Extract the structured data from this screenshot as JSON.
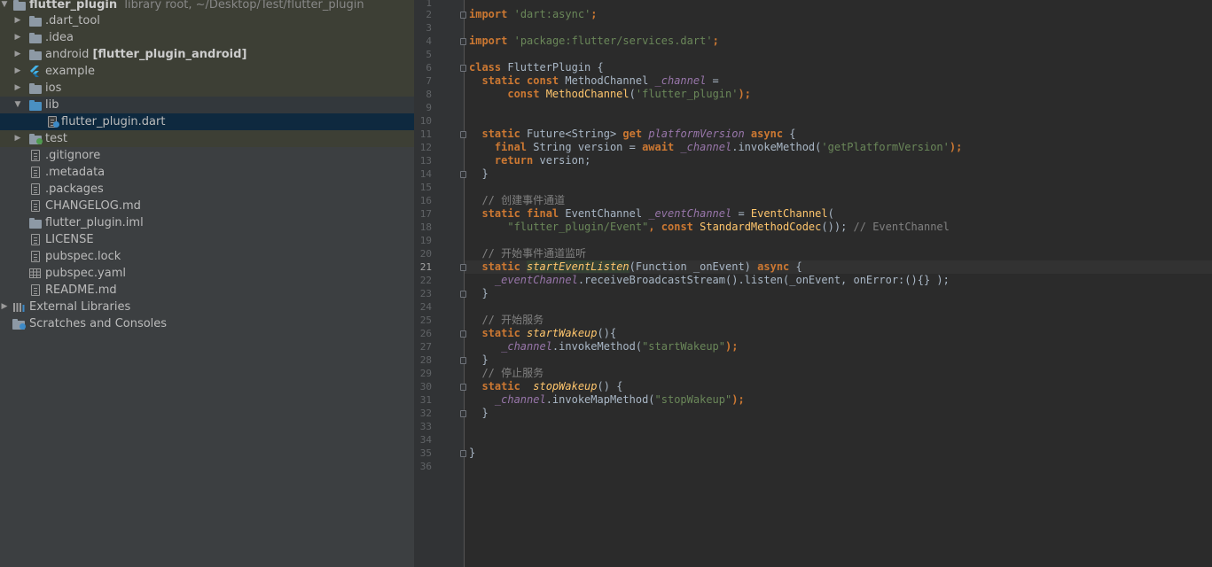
{
  "project_tree": {
    "root": {
      "name": "flutter_plugin",
      "subtitle": "library root,  ~/Desktop/Test/flutter_plugin"
    },
    "items": [
      {
        "label": ".dart_tool"
      },
      {
        "label": ".idea"
      },
      {
        "label": "android",
        "bold_suffix": "[flutter_plugin_android]"
      },
      {
        "label": "example"
      },
      {
        "label": "ios"
      },
      {
        "label": "lib"
      },
      {
        "label": "flutter_plugin.dart"
      },
      {
        "label": "test"
      },
      {
        "label": ".gitignore"
      },
      {
        "label": ".metadata"
      },
      {
        "label": ".packages"
      },
      {
        "label": "CHANGELOG.md"
      },
      {
        "label": "flutter_plugin.iml"
      },
      {
        "label": "LICENSE"
      },
      {
        "label": "pubspec.lock"
      },
      {
        "label": "pubspec.yaml"
      },
      {
        "label": "README.md"
      },
      {
        "label": "External Libraries"
      },
      {
        "label": "Scratches and Consoles"
      }
    ]
  },
  "editor": {
    "current_line": "21",
    "line_numbers": [
      "1",
      "2",
      "3",
      "4",
      "5",
      "6",
      "7",
      "8",
      "9",
      "10",
      "11",
      "12",
      "13",
      "14",
      "15",
      "16",
      "17",
      "18",
      "19",
      "20",
      "21",
      "22",
      "23",
      "24",
      "25",
      "26",
      "27",
      "28",
      "29",
      "30",
      "31",
      "32",
      "33",
      "34",
      "35",
      "36"
    ],
    "code": {
      "l2_kw": "import",
      "l2_str": "'dart:async'",
      "l2_end": ";",
      "l4_kw": "import",
      "l4_str": "'package:flutter/services.dart'",
      "l4_end": ";",
      "l6_kw": "class",
      "l6_rest": " FlutterPlugin {",
      "l7_kw": "static const",
      "l7_type": " MethodChannel ",
      "l7_fld": "_channel",
      "l7_end": " =",
      "l8_kw": "const",
      "l8_cls": " MethodChannel",
      "l8_p": "(",
      "l8_str": "'flutter_plugin'",
      "l8_end": ");",
      "l11_kw1": "static",
      "l11_type": " Future<String> ",
      "l11_kw2": "get",
      "l11_fld": " platformVersion ",
      "l11_kw3": "async",
      "l11_end": " {",
      "l12_kw1": "final",
      "l12_mid": " String version = ",
      "l12_kw2": "await",
      "l12_fld": " _channel",
      "l12_call": ".invokeMethod(",
      "l12_str": "'getPlatformVersion'",
      "l12_end": ");",
      "l13_kw": "return",
      "l13_rest": " version;",
      "l14": "}",
      "l16_cmt": "// 创建事件通道",
      "l17_kw": "static final",
      "l17_type": " EventChannel ",
      "l17_fld": "_eventChannel",
      "l17_eq": " = ",
      "l17_cls": "EventChannel",
      "l17_end": "(",
      "l18_str": "\"flutter_plugin/Event\"",
      "l18_comma": ", ",
      "l18_kw": "const",
      "l18_cls": " StandardMethodCodec",
      "l18_end": "()); ",
      "l18_cmt": "// EventChannel",
      "l20_cmt": "// 开始事件通道监听",
      "l21_kw": "static",
      "l21_fn": "startEventListen",
      "l21_mid": "(Function _onEvent) ",
      "l21_kw2": "async",
      "l21_end": " {",
      "l22_fld": "_eventChannel",
      "l22_mid": ".receiveBroadcastStream().listen(_onEvent, onError:(){} );",
      "l23": "}",
      "l25_cmt": "// 开始服务",
      "l26_kw": "static",
      "l26_fn": " startWakeup",
      "l26_end": "(){",
      "l27_fld": "_channel",
      "l27_call": ".invokeMethod(",
      "l27_str": "\"startWakeup\"",
      "l27_end": ");",
      "l28": "}",
      "l29_cmt": "// 停止服务",
      "l30_kw": "static",
      "l30_fn": "  stopWakeup",
      "l30_end": "() {",
      "l31_fld": "_channel",
      "l31_call": ".invokeMapMethod(",
      "l31_str": "\"stopWakeup\"",
      "l31_end": ");",
      "l32": "}",
      "l35": "}"
    }
  }
}
